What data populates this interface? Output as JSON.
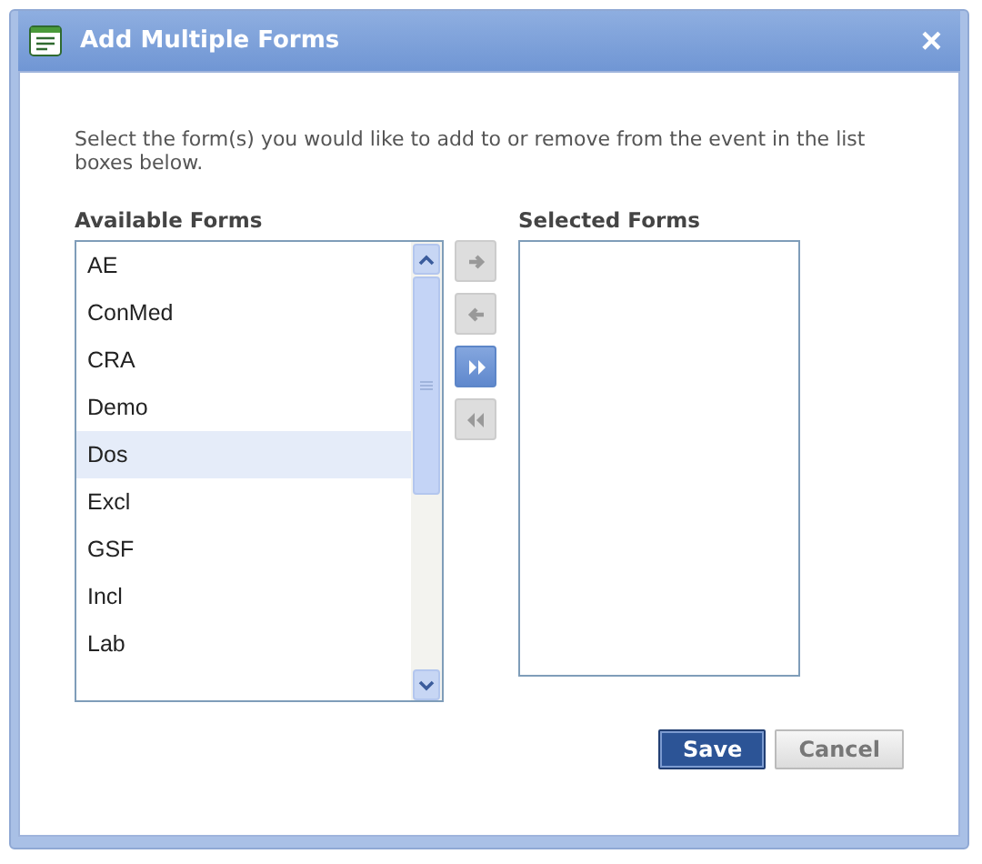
{
  "window": {
    "title": "Add Multiple Forms",
    "close": "×"
  },
  "instructions": "Select the form(s) you would like to add to or remove from the event in the list boxes below.",
  "available": {
    "heading": "Available Forms",
    "items": [
      {
        "label": "AE",
        "selected": false
      },
      {
        "label": "ConMed",
        "selected": false
      },
      {
        "label": "CRA",
        "selected": false
      },
      {
        "label": "Demo",
        "selected": false
      },
      {
        "label": "Dos",
        "selected": true
      },
      {
        "label": "Excl",
        "selected": false
      },
      {
        "label": "GSF",
        "selected": false
      },
      {
        "label": "Incl",
        "selected": false
      },
      {
        "label": "Lab",
        "selected": false
      }
    ]
  },
  "move_buttons": [
    {
      "kind": "add",
      "disabled": true
    },
    {
      "kind": "remove",
      "disabled": true
    },
    {
      "kind": "add_all",
      "disabled": false
    },
    {
      "kind": "remove_all",
      "disabled": true
    }
  ],
  "selected": {
    "heading": "Selected Forms"
  },
  "buttons": [
    {
      "label": "Save",
      "kind": "primary"
    },
    {
      "label": "Cancel",
      "kind": "secondary"
    }
  ]
}
